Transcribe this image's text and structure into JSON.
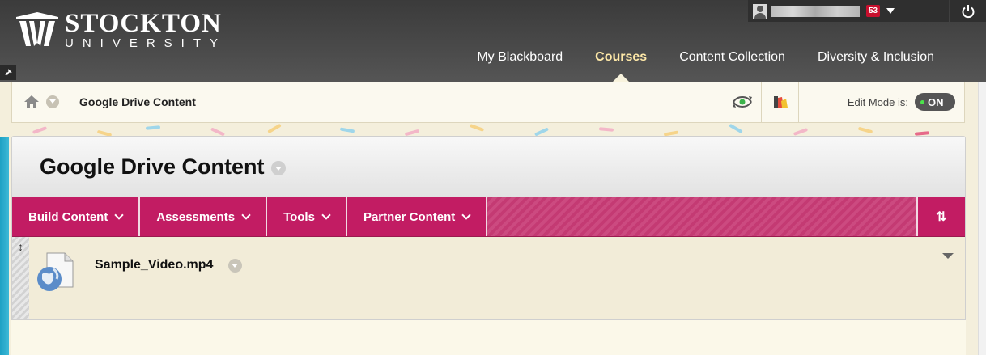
{
  "header": {
    "logo_name": "STOCKTON",
    "logo_sub": "UNIVERSITY",
    "user_name": "",
    "notification_count": "53",
    "nav_tabs": [
      {
        "label": "My Blackboard",
        "active": false
      },
      {
        "label": "Courses",
        "active": true
      },
      {
        "label": "Content Collection",
        "active": false
      },
      {
        "label": "Diversity & Inclusion",
        "active": false
      }
    ]
  },
  "breadcrumb": {
    "title": "Google Drive Content",
    "edit_mode_label": "Edit Mode is:",
    "edit_mode_state": "ON"
  },
  "page": {
    "title": "Google Drive Content"
  },
  "action_bar": {
    "items": [
      {
        "label": "Build Content"
      },
      {
        "label": "Assessments"
      },
      {
        "label": "Tools"
      },
      {
        "label": "Partner Content"
      }
    ],
    "reorder_label": "⇅"
  },
  "content_items": [
    {
      "title": "Sample_Video.mp4"
    }
  ],
  "colors": {
    "header_bg": "#444444",
    "active_tab": "#ffe9a8",
    "action_bar": "#c21c63",
    "content_bg": "#f2ecd8",
    "notification_badge": "#c8102e",
    "left_accent": "#1da1c4"
  },
  "icons": [
    "logo-mark",
    "user-avatar-icon",
    "caret-down-icon",
    "power-icon",
    "pin-icon",
    "home-icon",
    "eye-refresh-icon",
    "color-palette-icon",
    "file-globe-icon",
    "drag-handle-icon",
    "item-menu-icon"
  ]
}
